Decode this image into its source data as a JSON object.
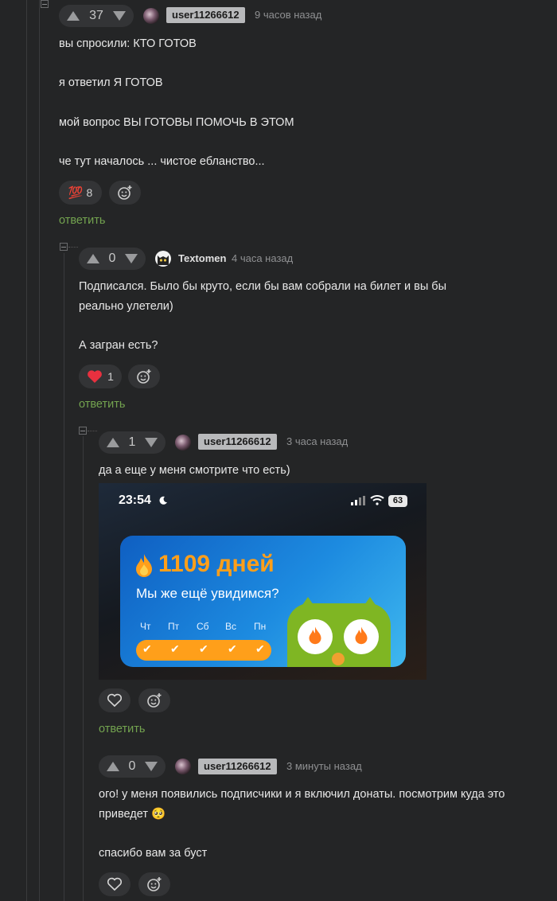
{
  "comments": [
    {
      "votes": "37",
      "user": "user11266612",
      "time": "9 часов назад",
      "lines": [
        "вы спросили: КТО ГОТОВ",
        "я ответил Я ГОТОВ",
        "мой вопрос ВЫ ГОТОВЫ ПОМОЧЬ В ЭТОМ",
        "че тут началось ... чистое ебланство..."
      ],
      "reaction_emoji": "💯",
      "reaction_count": "8",
      "reply": "ответить"
    },
    {
      "votes": "0",
      "user": "Textomen",
      "time": "4 часа назад",
      "lines": [
        "Подписался. Было бы круто, если бы вам собрали на билет и вы бы",
        "реально улетели)",
        "А загран есть?"
      ],
      "reaction_count": "1",
      "reply": "ответить"
    },
    {
      "votes": "1",
      "user": "user11266612",
      "time": "3 часа назад",
      "lines": [
        "да а еще у меня смотрите что есть)"
      ],
      "reply": "ответить",
      "image": {
        "clock": "23:54",
        "battery": "63",
        "streak": "1109 дней",
        "subtitle": "Мы же ещё увидимся?",
        "days": [
          "Чт",
          "Пт",
          "Сб",
          "Вс",
          "Пн"
        ],
        "check": "✔"
      }
    },
    {
      "votes": "0",
      "user": "user11266612",
      "time": "3 минуты назад",
      "lines": [
        "ого! у меня появились подписчики и я включил донаты. посмотрим куда это",
        "приведет 🥺",
        "спасибо вам за буст"
      ]
    }
  ],
  "icons": {
    "heart": "heart-icon",
    "add_reaction": "add-reaction-icon",
    "vote_up": "arrow-up-icon",
    "vote_down": "arrow-down-icon"
  },
  "colors": {
    "background": "#242526",
    "reply_link": "#73a34f",
    "heart": "#e8303f",
    "badge": "#b8b9bb"
  }
}
